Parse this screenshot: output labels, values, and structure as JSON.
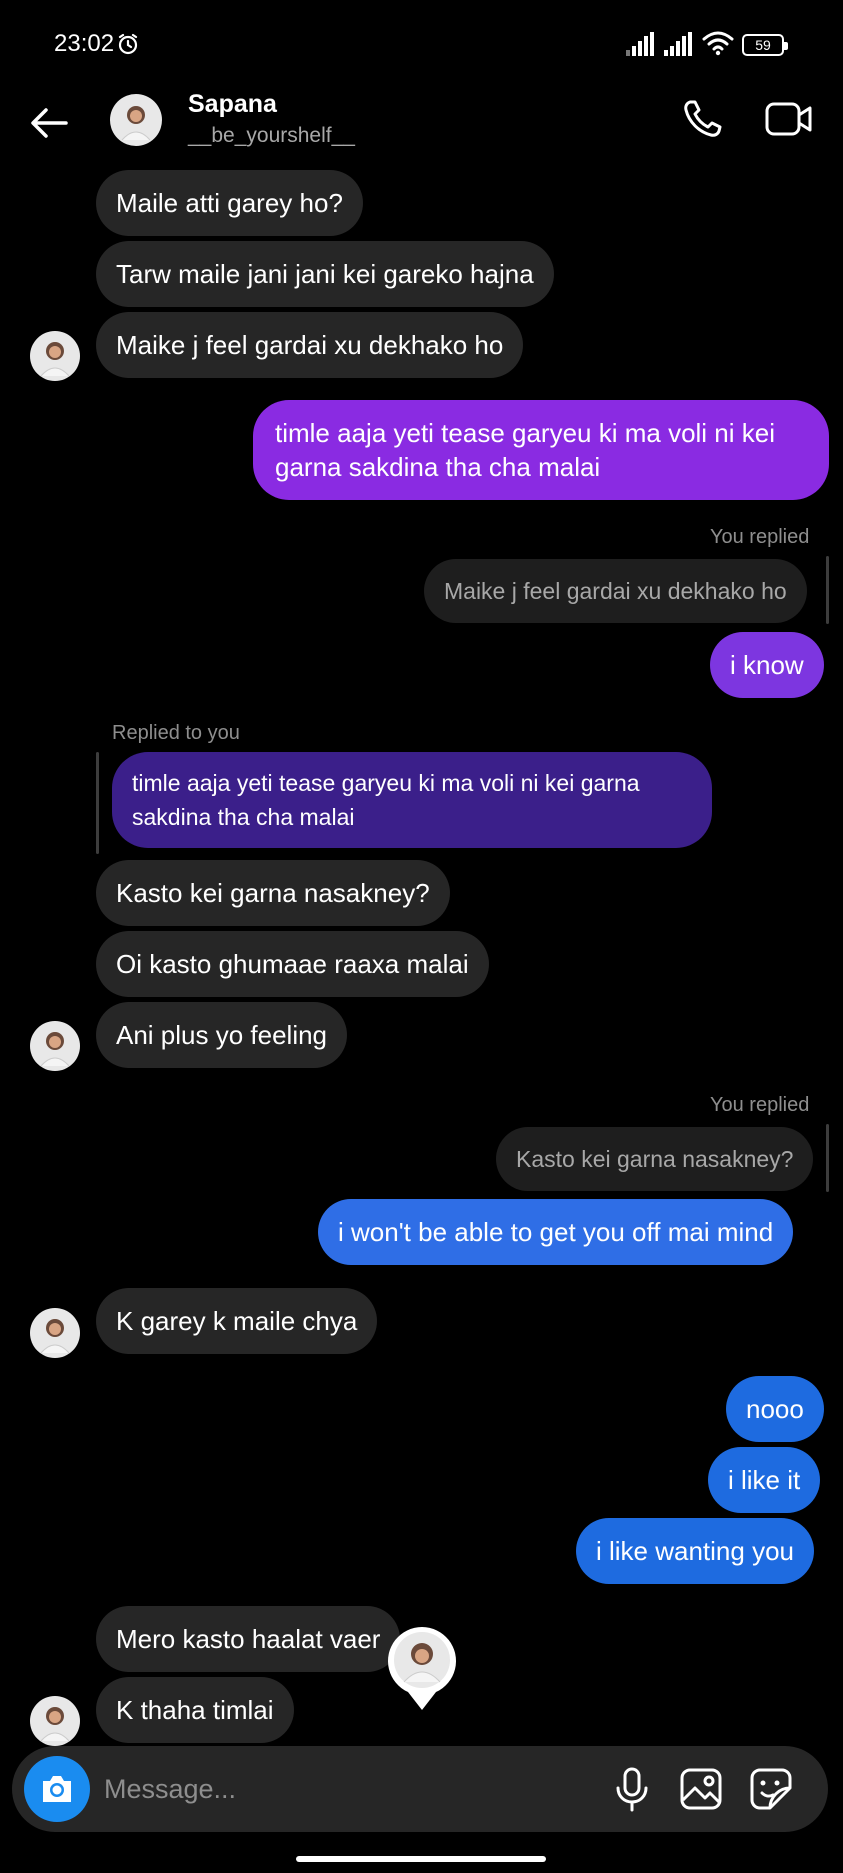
{
  "status": {
    "time": "23:02",
    "battery": "59"
  },
  "header": {
    "name": "Sapana",
    "username": "__be_yourshelf__"
  },
  "messages": {
    "m1": "Maile atti garey ho?",
    "m2": "Tarw maile jani jani kei gareko hajna",
    "m3": "Maike j feel gardai xu dekhako ho",
    "m4": "timle aaja yeti tease garyeu ki ma voli ni kei garna sakdina tha cha malai",
    "r1_label": "You replied",
    "r1_quote": "Maike j feel gardai xu dekhako ho",
    "m5": "i know",
    "r2_label": "Replied to you",
    "r2_quote": "timle aaja yeti tease garyeu ki ma voli ni kei garna sakdina tha cha malai",
    "m6": "Kasto kei garna nasakney?",
    "m7": "Oi kasto ghumaae raaxa malai",
    "m8": "Ani plus yo feeling",
    "r3_label": "You replied",
    "r3_quote": "Kasto kei garna nasakney?",
    "m9": "i won't be able to get you off mai mind",
    "m10": "K garey k maile chya",
    "m11": "nooo",
    "m12": "i like it",
    "m13": "i like wanting you",
    "m14": "Mero kasto haalat vaer",
    "m15": "K thaha timlai"
  },
  "composer": {
    "placeholder": "Message..."
  },
  "colors": {
    "incoming": "#262626",
    "outgoing_purple": "#8a2be2",
    "outgoing_blue": "#2f6ee6",
    "camera": "#1a8cf0"
  },
  "icons": [
    "back-arrow-icon",
    "phone-icon",
    "video-icon",
    "camera-icon",
    "mic-icon",
    "gallery-icon",
    "sticker-icon",
    "alarm-icon",
    "signal-icon",
    "wifi-icon",
    "battery-icon"
  ]
}
